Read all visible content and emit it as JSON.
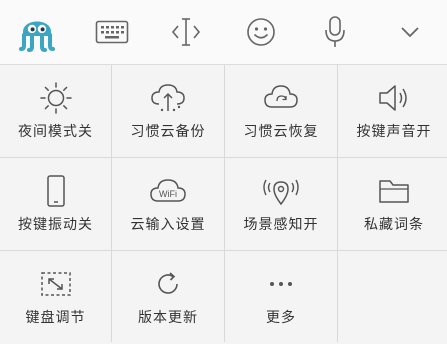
{
  "colors": {
    "brand": "#3aa6c4",
    "icon_gray": "#555555",
    "grid_line": "#d9d9d9",
    "cell_bg": "#f4f4f4"
  },
  "toolbar": {
    "items": [
      {
        "name": "logo",
        "icon": "octopus-logo-icon"
      },
      {
        "name": "keyboard",
        "icon": "keyboard-icon"
      },
      {
        "name": "cursor",
        "icon": "text-cursor-icon"
      },
      {
        "name": "emoji",
        "icon": "smiley-icon"
      },
      {
        "name": "voice",
        "icon": "microphone-icon"
      },
      {
        "name": "collapse",
        "icon": "chevron-down-icon"
      }
    ]
  },
  "grid": {
    "items": [
      {
        "label": "夜间模式关",
        "icon": "sun-icon"
      },
      {
        "label": "习惯云备份",
        "icon": "cloud-upload-icon"
      },
      {
        "label": "习惯云恢复",
        "icon": "cloud-refresh-icon"
      },
      {
        "label": "按键声音开",
        "icon": "speaker-icon"
      },
      {
        "label": "按键振动关",
        "icon": "phone-icon"
      },
      {
        "label": "云输入设置",
        "icon": "cloud-wifi-icon",
        "icon_text": "WiFi"
      },
      {
        "label": "场景感知开",
        "icon": "location-signal-icon"
      },
      {
        "label": "私藏词条",
        "icon": "folder-icon"
      },
      {
        "label": "键盘调节",
        "icon": "resize-icon"
      },
      {
        "label": "版本更新",
        "icon": "refresh-icon"
      },
      {
        "label": "更多",
        "icon": "more-dots-icon"
      }
    ]
  }
}
